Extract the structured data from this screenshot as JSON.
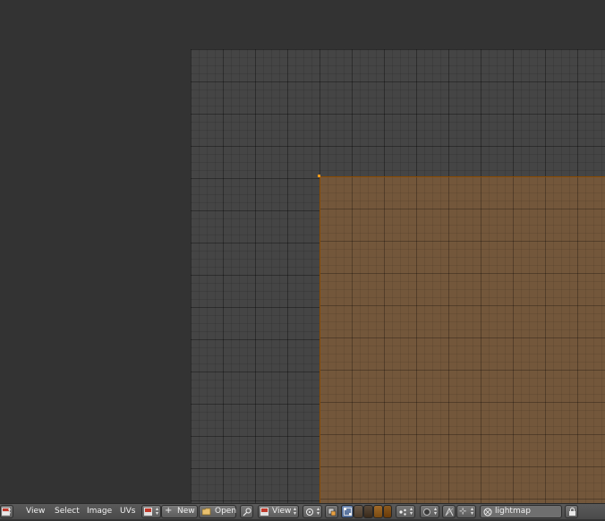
{
  "header": {
    "menus": {
      "view": "View",
      "select": "Select",
      "image": "Image",
      "uvs": "UVs"
    },
    "image_browse": {
      "new_label": "New",
      "open_label": "Open"
    },
    "pivot_view_label": "View",
    "uv_map_name": "lightmap"
  },
  "icons": {
    "editor_type": "image-editor-icon",
    "new": "plus-icon",
    "open": "folder-icon",
    "pin": "pin-icon",
    "pivot": "pivot-icon",
    "sync": "sync-icon",
    "select_mode": "select-mode-icon",
    "sticky": "sticky-icon",
    "proportional": "proportional-edit-icon",
    "snap": "snap-icon",
    "lock": "lock-icon"
  },
  "colors": {
    "background": "#333333",
    "grid": "#454545",
    "uv_face": "#73573b",
    "uv_edge": "#8a4a00",
    "uv_vertex": "#ff9a1a",
    "header": "#4f4f4f"
  }
}
